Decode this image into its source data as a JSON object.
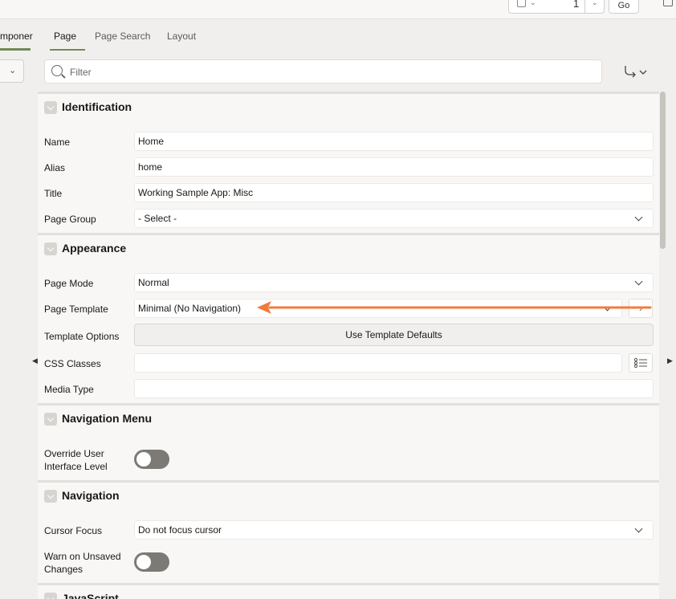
{
  "toolbar": {
    "page_number": "1",
    "go_label": "Go"
  },
  "left_panel": {
    "tab_label": "mponer"
  },
  "tabs": [
    {
      "label": "Page",
      "active": true
    },
    {
      "label": "Page Search",
      "active": false
    },
    {
      "label": "Layout",
      "active": false
    }
  ],
  "filter": {
    "placeholder": "Filter",
    "value": ""
  },
  "identification": {
    "title": "Identification",
    "name_label": "Name",
    "name_value": "Home",
    "alias_label": "Alias",
    "alias_value": "home",
    "title_label": "Title",
    "title_value": "Working Sample App: Misc",
    "page_group_label": "Page Group",
    "page_group_value": "- Select -"
  },
  "appearance": {
    "title": "Appearance",
    "page_mode_label": "Page Mode",
    "page_mode_value": "Normal",
    "page_template_label": "Page Template",
    "page_template_value": "Minimal (No Navigation)",
    "template_options_label": "Template Options",
    "template_options_button": "Use Template Defaults",
    "css_classes_label": "CSS Classes",
    "css_classes_value": "",
    "media_type_label": "Media Type",
    "media_type_value": ""
  },
  "navigation_menu": {
    "title": "Navigation Menu",
    "override_label_line1": "Override User",
    "override_label_line2": "Interface Level",
    "override_on": false
  },
  "navigation": {
    "title": "Navigation",
    "cursor_focus_label": "Cursor Focus",
    "cursor_focus_value": "Do not focus cursor",
    "warn_label_line1": "Warn on Unsaved",
    "warn_label_line2": "Changes",
    "warn_on": false
  },
  "javascript": {
    "title": "JavaScript"
  },
  "colors": {
    "accent_tab": "#6f8a57",
    "annotation_arrow": "#f07c3c",
    "toggle_off": "#7d7975"
  }
}
